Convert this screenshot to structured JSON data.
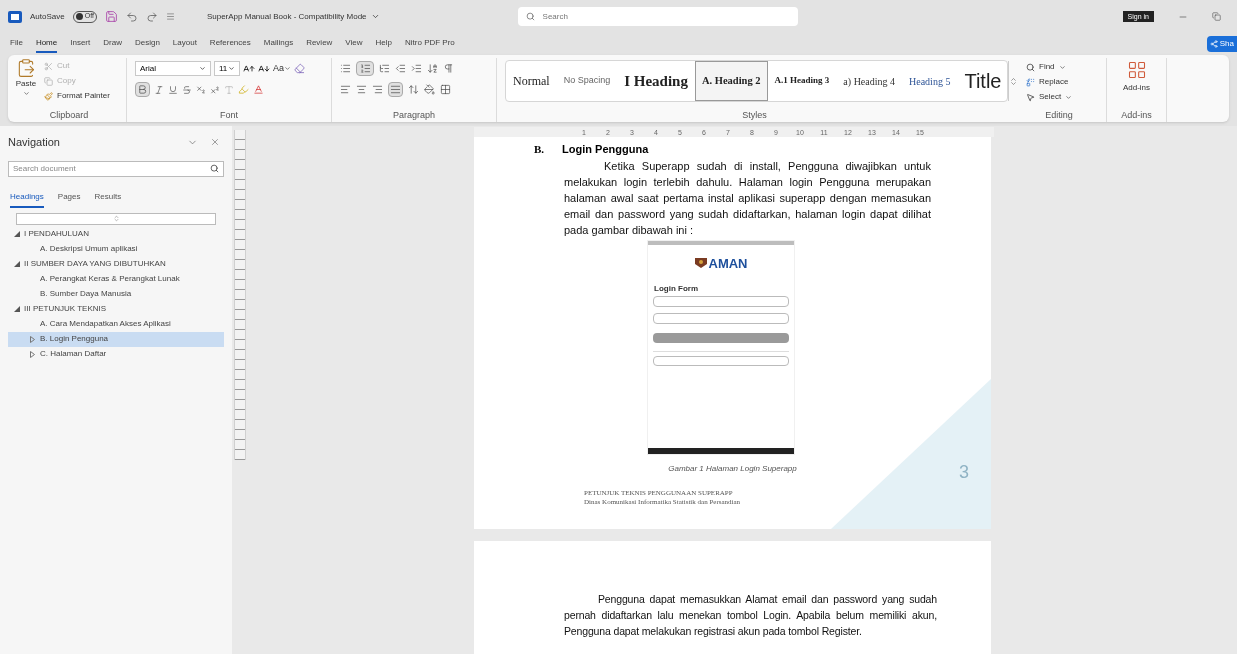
{
  "title_bar": {
    "autosave_label": "AutoSave",
    "autosave_state": "Off",
    "autosave_on": false,
    "document_title": "SuperApp Manual Book - Compatibility Mode",
    "search_placeholder": "Search",
    "sign_in": "Sign in"
  },
  "menu_tabs": [
    {
      "label": "File",
      "selected": false
    },
    {
      "label": "Home",
      "selected": true
    },
    {
      "label": "Insert",
      "selected": false
    },
    {
      "label": "Draw",
      "selected": false
    },
    {
      "label": "Design",
      "selected": false
    },
    {
      "label": "Layout",
      "selected": false
    },
    {
      "label": "References",
      "selected": false
    },
    {
      "label": "Mailings",
      "selected": false
    },
    {
      "label": "Review",
      "selected": false
    },
    {
      "label": "View",
      "selected": false
    },
    {
      "label": "Help",
      "selected": false
    },
    {
      "label": "Nitro PDF Pro",
      "selected": false
    }
  ],
  "share_button": "Sha",
  "ribbon": {
    "clipboard": {
      "label": "Clipboard",
      "paste": "Paste",
      "cut": "Cut",
      "cut_disabled": true,
      "copy": "Copy",
      "copy_disabled": true,
      "format_painter": "Format Painter"
    },
    "font": {
      "label": "Font",
      "font_name": "Arial",
      "font_size": "11",
      "change_case": "Aa",
      "bold_on": true
    },
    "paragraph": {
      "label": "Paragraph",
      "numbering_on": true,
      "justify_on": true
    },
    "styles": {
      "label": "Styles",
      "items": [
        {
          "label": "Normal",
          "kind": "normal",
          "selected": false
        },
        {
          "label": "No Spacing",
          "kind": "no_spacing",
          "selected": false
        },
        {
          "label": "I Heading",
          "kind": "heading1",
          "selected": false
        },
        {
          "label": "A. Heading 2",
          "kind": "heading2",
          "selected": true
        },
        {
          "label": "A.1 Heading 3",
          "kind": "heading3",
          "selected": false
        },
        {
          "label": "a) Heading 4",
          "kind": "heading4",
          "selected": false
        },
        {
          "label": "Heading 5",
          "kind": "heading5",
          "selected": false
        },
        {
          "label": "Title",
          "kind": "title",
          "selected": false
        }
      ]
    },
    "editing": {
      "label": "Editing",
      "find": "Find",
      "replace": "Replace",
      "select": "Select"
    },
    "addins": {
      "button": "Add-ins",
      "label": "Add-ins"
    }
  },
  "navigation": {
    "title": "Navigation",
    "search_placeholder": "Search document",
    "tabs": [
      {
        "label": "Headings",
        "selected": true
      },
      {
        "label": "Pages",
        "selected": false
      },
      {
        "label": "Results",
        "selected": false
      }
    ],
    "tree": [
      {
        "label": "I PENDAHULUAN",
        "expanded": true,
        "selected": false,
        "children": [
          {
            "label": "A. Deskripsi Umum aplikasi",
            "selected": false
          }
        ]
      },
      {
        "label": "II SUMBER DAYA YANG DIBUTUHKAN",
        "expanded": true,
        "selected": false,
        "children": [
          {
            "label": "A. Perangkat Keras & Perangkat Lunak",
            "selected": false
          },
          {
            "label": "B. Sumber Daya Manusia",
            "selected": false
          }
        ]
      },
      {
        "label": "III PETUNJUK TEKNIS",
        "expanded": true,
        "selected": false,
        "children": [
          {
            "label": "A. Cara Mendapatkan Akses Aplikasi",
            "selected": false
          },
          {
            "label": "B. Login Pengguna",
            "expanded": false,
            "selected": true
          },
          {
            "label": "C. Halaman Daftar",
            "expanded": false,
            "selected": false
          }
        ]
      }
    ]
  },
  "ruler_numbers": [
    "1",
    "2",
    "3",
    "4",
    "5",
    "6",
    "7",
    "8",
    "9",
    "10",
    "11",
    "12",
    "13",
    "14",
    "15"
  ],
  "page_1": {
    "heading_number": "B.",
    "heading": "Login Pengguna",
    "paragraph": "Ketika Superapp sudah di install, Pengguna diwajibkan untuk melakukan login terlebih dahulu. Halaman login Pengguna merupakan halaman awal saat pertama instal aplikasi superapp dengan memasukan email dan password yang sudah didaftarkan, halaman login dapat dilihat pada gambar dibawah ini :",
    "figure": {
      "logo_text": "AMAN",
      "form_title": "Login Form"
    },
    "caption": "Gambar 1 Halaman Login Superapp",
    "footer_title": "PETUNJUK TEKNIS PENGGUNAAN SUPERAPP",
    "footer_subtitle": "Dinas Komunikasi Informatika Statistik dan Persandian",
    "page_number": "3"
  },
  "page_2": {
    "paragraph": "Pengguna dapat memasukkan Alamat email dan password yang sudah pernah didaftarkan lalu menekan tombol Login. Apabila belum memiliki akun, Pengguna dapat melakukan registrasi akun pada tombol Register."
  }
}
